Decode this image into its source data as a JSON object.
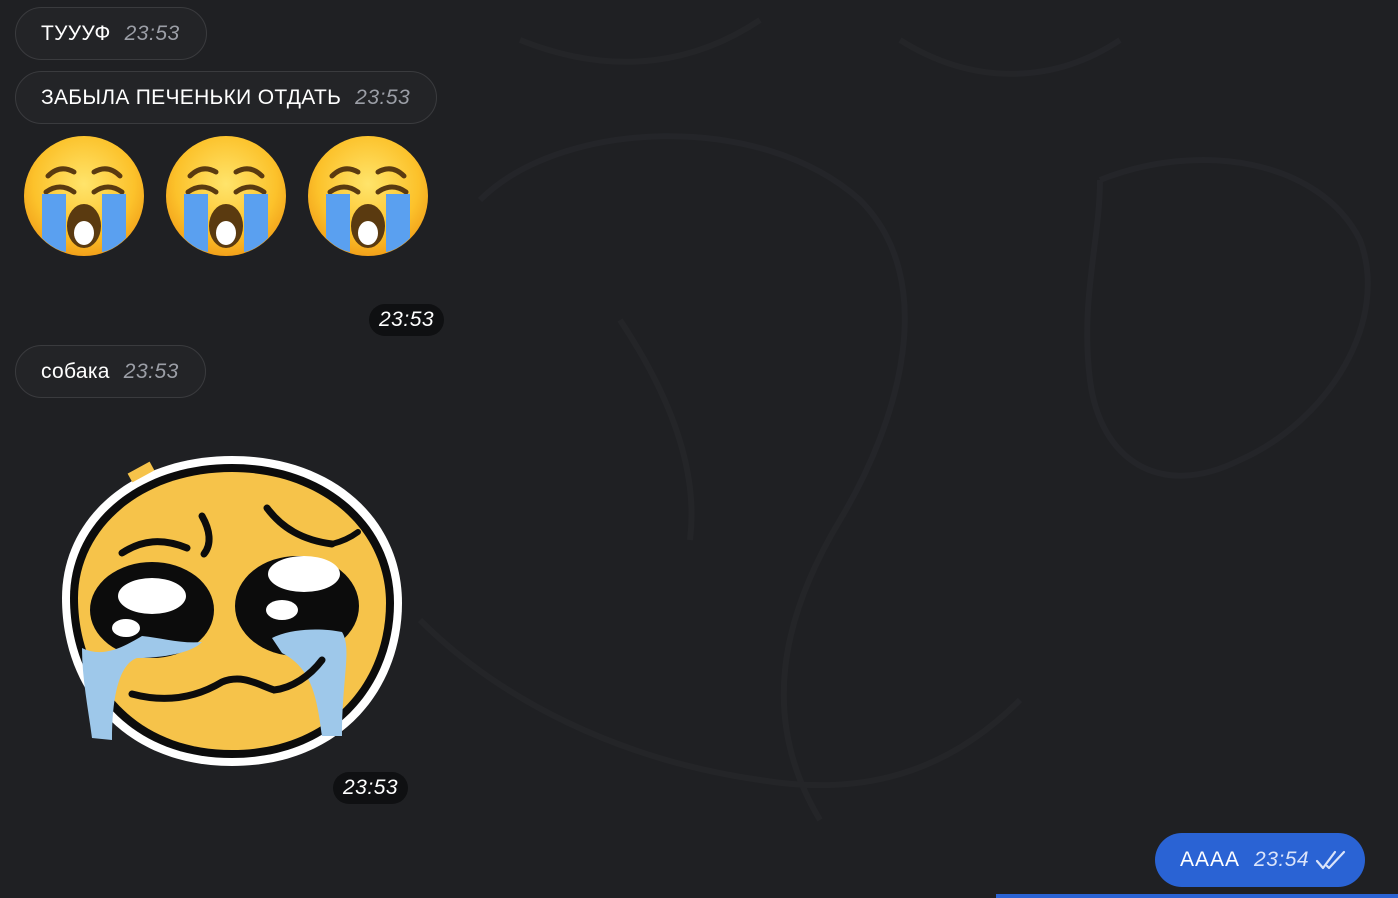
{
  "messages": [
    {
      "text": "ТУУУФ",
      "time": "23:53"
    },
    {
      "text": "ЗАБЫЛА ПЕЧЕНЬКИ ОТДАТЬ",
      "time": "23:53"
    },
    {
      "emoji_time": "23:53"
    },
    {
      "text": "собака",
      "time": "23:53"
    },
    {
      "sticker_time": "23:53"
    }
  ],
  "emojis": [
    "loudly-crying-face",
    "loudly-crying-face",
    "loudly-crying-face"
  ],
  "outgoing": {
    "text": "АААА",
    "time": "23:54",
    "status_icon": "double-check-icon"
  },
  "colors": {
    "background": "#1f2023",
    "incoming_bubble": "#232427",
    "outgoing_bubble": "#2a63d4",
    "time_muted": "#9b9ea6"
  }
}
